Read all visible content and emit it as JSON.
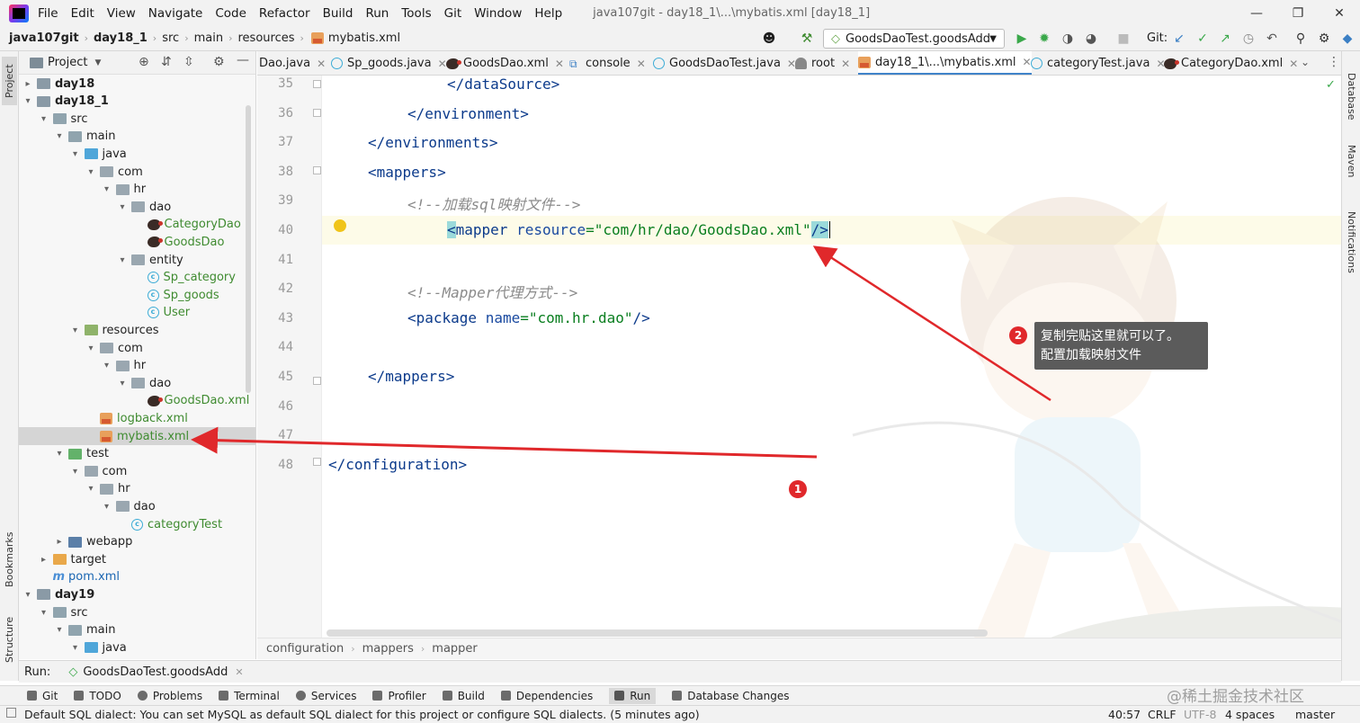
{
  "menubar": {
    "items": [
      "File",
      "Edit",
      "View",
      "Navigate",
      "Code",
      "Refactor",
      "Build",
      "Run",
      "Tools",
      "Git",
      "Window",
      "Help"
    ],
    "title": "java107git - day18_1\\...\\mybatis.xml [day18_1]"
  },
  "navbar": {
    "crumbs": [
      "java107git",
      "day18_1",
      "src",
      "main",
      "resources",
      "mybatis.xml"
    ],
    "run_config": "GoodsDaoTest.goodsAdd",
    "git_label": "Git:"
  },
  "project": {
    "header": "Project",
    "tree": [
      {
        "label": "day18",
        "depth": 0,
        "arrow": "right",
        "icon": "module",
        "bold": true
      },
      {
        "label": "day18_1",
        "depth": 0,
        "arrow": "down",
        "icon": "module",
        "bold": true
      },
      {
        "label": "src",
        "depth": 1,
        "arrow": "down",
        "icon": "folder"
      },
      {
        "label": "main",
        "depth": 2,
        "arrow": "down",
        "icon": "folder"
      },
      {
        "label": "java",
        "depth": 3,
        "arrow": "down",
        "icon": "src"
      },
      {
        "label": "com",
        "depth": 4,
        "arrow": "down",
        "icon": "package"
      },
      {
        "label": "hr",
        "depth": 5,
        "arrow": "down",
        "icon": "package"
      },
      {
        "label": "dao",
        "depth": 6,
        "arrow": "down",
        "icon": "package"
      },
      {
        "label": "CategoryDao",
        "depth": 7,
        "arrow": "",
        "icon": "mybatis",
        "color": "green"
      },
      {
        "label": "GoodsDao",
        "depth": 7,
        "arrow": "",
        "icon": "mybatis",
        "color": "green"
      },
      {
        "label": "entity",
        "depth": 6,
        "arrow": "down",
        "icon": "package"
      },
      {
        "label": "Sp_category",
        "depth": 7,
        "arrow": "",
        "icon": "class",
        "color": "green"
      },
      {
        "label": "Sp_goods",
        "depth": 7,
        "arrow": "",
        "icon": "class",
        "color": "green"
      },
      {
        "label": "User",
        "depth": 7,
        "arrow": "",
        "icon": "class",
        "color": "green"
      },
      {
        "label": "resources",
        "depth": 3,
        "arrow": "down",
        "icon": "resources"
      },
      {
        "label": "com",
        "depth": 4,
        "arrow": "down",
        "icon": "package"
      },
      {
        "label": "hr",
        "depth": 5,
        "arrow": "down",
        "icon": "package"
      },
      {
        "label": "dao",
        "depth": 6,
        "arrow": "down",
        "icon": "package"
      },
      {
        "label": "GoodsDao.xml",
        "depth": 7,
        "arrow": "",
        "icon": "mybatis",
        "color": "green"
      },
      {
        "label": "logback.xml",
        "depth": 4,
        "arrow": "",
        "icon": "xml",
        "color": "green"
      },
      {
        "label": "mybatis.xml",
        "depth": 4,
        "arrow": "",
        "icon": "xml",
        "color": "green",
        "selected": true
      },
      {
        "label": "test",
        "depth": 2,
        "arrow": "down",
        "icon": "test"
      },
      {
        "label": "com",
        "depth": 3,
        "arrow": "down",
        "icon": "package"
      },
      {
        "label": "hr",
        "depth": 4,
        "arrow": "down",
        "icon": "package"
      },
      {
        "label": "dao",
        "depth": 5,
        "arrow": "down",
        "icon": "package"
      },
      {
        "label": "categoryTest",
        "depth": 6,
        "arrow": "",
        "icon": "class",
        "color": "green"
      },
      {
        "label": "webapp",
        "depth": 2,
        "arrow": "right",
        "icon": "web"
      },
      {
        "label": "target",
        "depth": 1,
        "arrow": "right",
        "icon": "orange"
      },
      {
        "label": "pom.xml",
        "depth": 1,
        "arrow": "",
        "icon": "maven",
        "color": "blue"
      },
      {
        "label": "day19",
        "depth": 0,
        "arrow": "down",
        "icon": "module",
        "bold": true
      },
      {
        "label": "src",
        "depth": 1,
        "arrow": "down",
        "icon": "folder"
      },
      {
        "label": "main",
        "depth": 2,
        "arrow": "down",
        "icon": "folder"
      },
      {
        "label": "java",
        "depth": 3,
        "arrow": "down",
        "icon": "src"
      }
    ]
  },
  "tabs": [
    {
      "label": "Dao.java"
    },
    {
      "label": "Sp_goods.java"
    },
    {
      "label": "GoodsDao.xml"
    },
    {
      "label": "console"
    },
    {
      "label": "GoodsDaoTest.java"
    },
    {
      "label": "root"
    },
    {
      "label": "day18_1\\...\\mybatis.xml",
      "active": true
    },
    {
      "label": "categoryTest.java"
    },
    {
      "label": "CategoryDao.xml"
    }
  ],
  "editor": {
    "line_numbers": [
      "35",
      "36",
      "37",
      "38",
      "39",
      "40",
      "41",
      "42",
      "43",
      "44",
      "45",
      "46",
      "47",
      "48"
    ],
    "lines": {
      "l35": "</dataSource>",
      "l36": "</environment>",
      "l37": "</environments>",
      "l38": "<mappers>",
      "l39": "<!--加载sql映射文件-->",
      "l40_open": "<",
      "l40_tag": "mapper",
      "l40_attr": "resource",
      "l40_eq": "=",
      "l40_val": "\"com/hr/dao/GoodsDao.xml\"",
      "l40_close": "/>",
      "l42": "<!--Mapper代理方式-->",
      "l43_tag": "<package",
      "l43_attr": "name",
      "l43_val": "\"com.hr.dao\"",
      "l43_close": "/>",
      "l45": "</mappers>",
      "l48": "</configuration>"
    }
  },
  "annotations": {
    "badge1": "1",
    "badge2": "2",
    "callout_line1": "复制完贴这里就可以了。",
    "callout_line2": "配置加载映射文件",
    "arrow_color": "#e0282b"
  },
  "edcrumbs": [
    "configuration",
    "mappers",
    "mapper"
  ],
  "runbar": {
    "label": "Run:",
    "tab": "GoodsDaoTest.goodsAdd"
  },
  "tooltabs": [
    "Git",
    "TODO",
    "Problems",
    "Terminal",
    "Services",
    "Profiler",
    "Build",
    "Dependencies",
    "Run",
    "Database Changes"
  ],
  "stripes": {
    "left": [
      "Project",
      "Bookmarks",
      "Structure"
    ],
    "right": [
      "Database",
      "Maven",
      "Notifications"
    ]
  },
  "status": {
    "message": "Default SQL dialect: You can set MySQL as default SQL dialect for this project or configure SQL dialects. (5 minutes ago)",
    "position": "40:57",
    "line_sep": "CRLF",
    "encoding": "UTF-8",
    "indent": "4 spaces",
    "branch": "master"
  },
  "watermark": "@稀土掘金技术社区"
}
